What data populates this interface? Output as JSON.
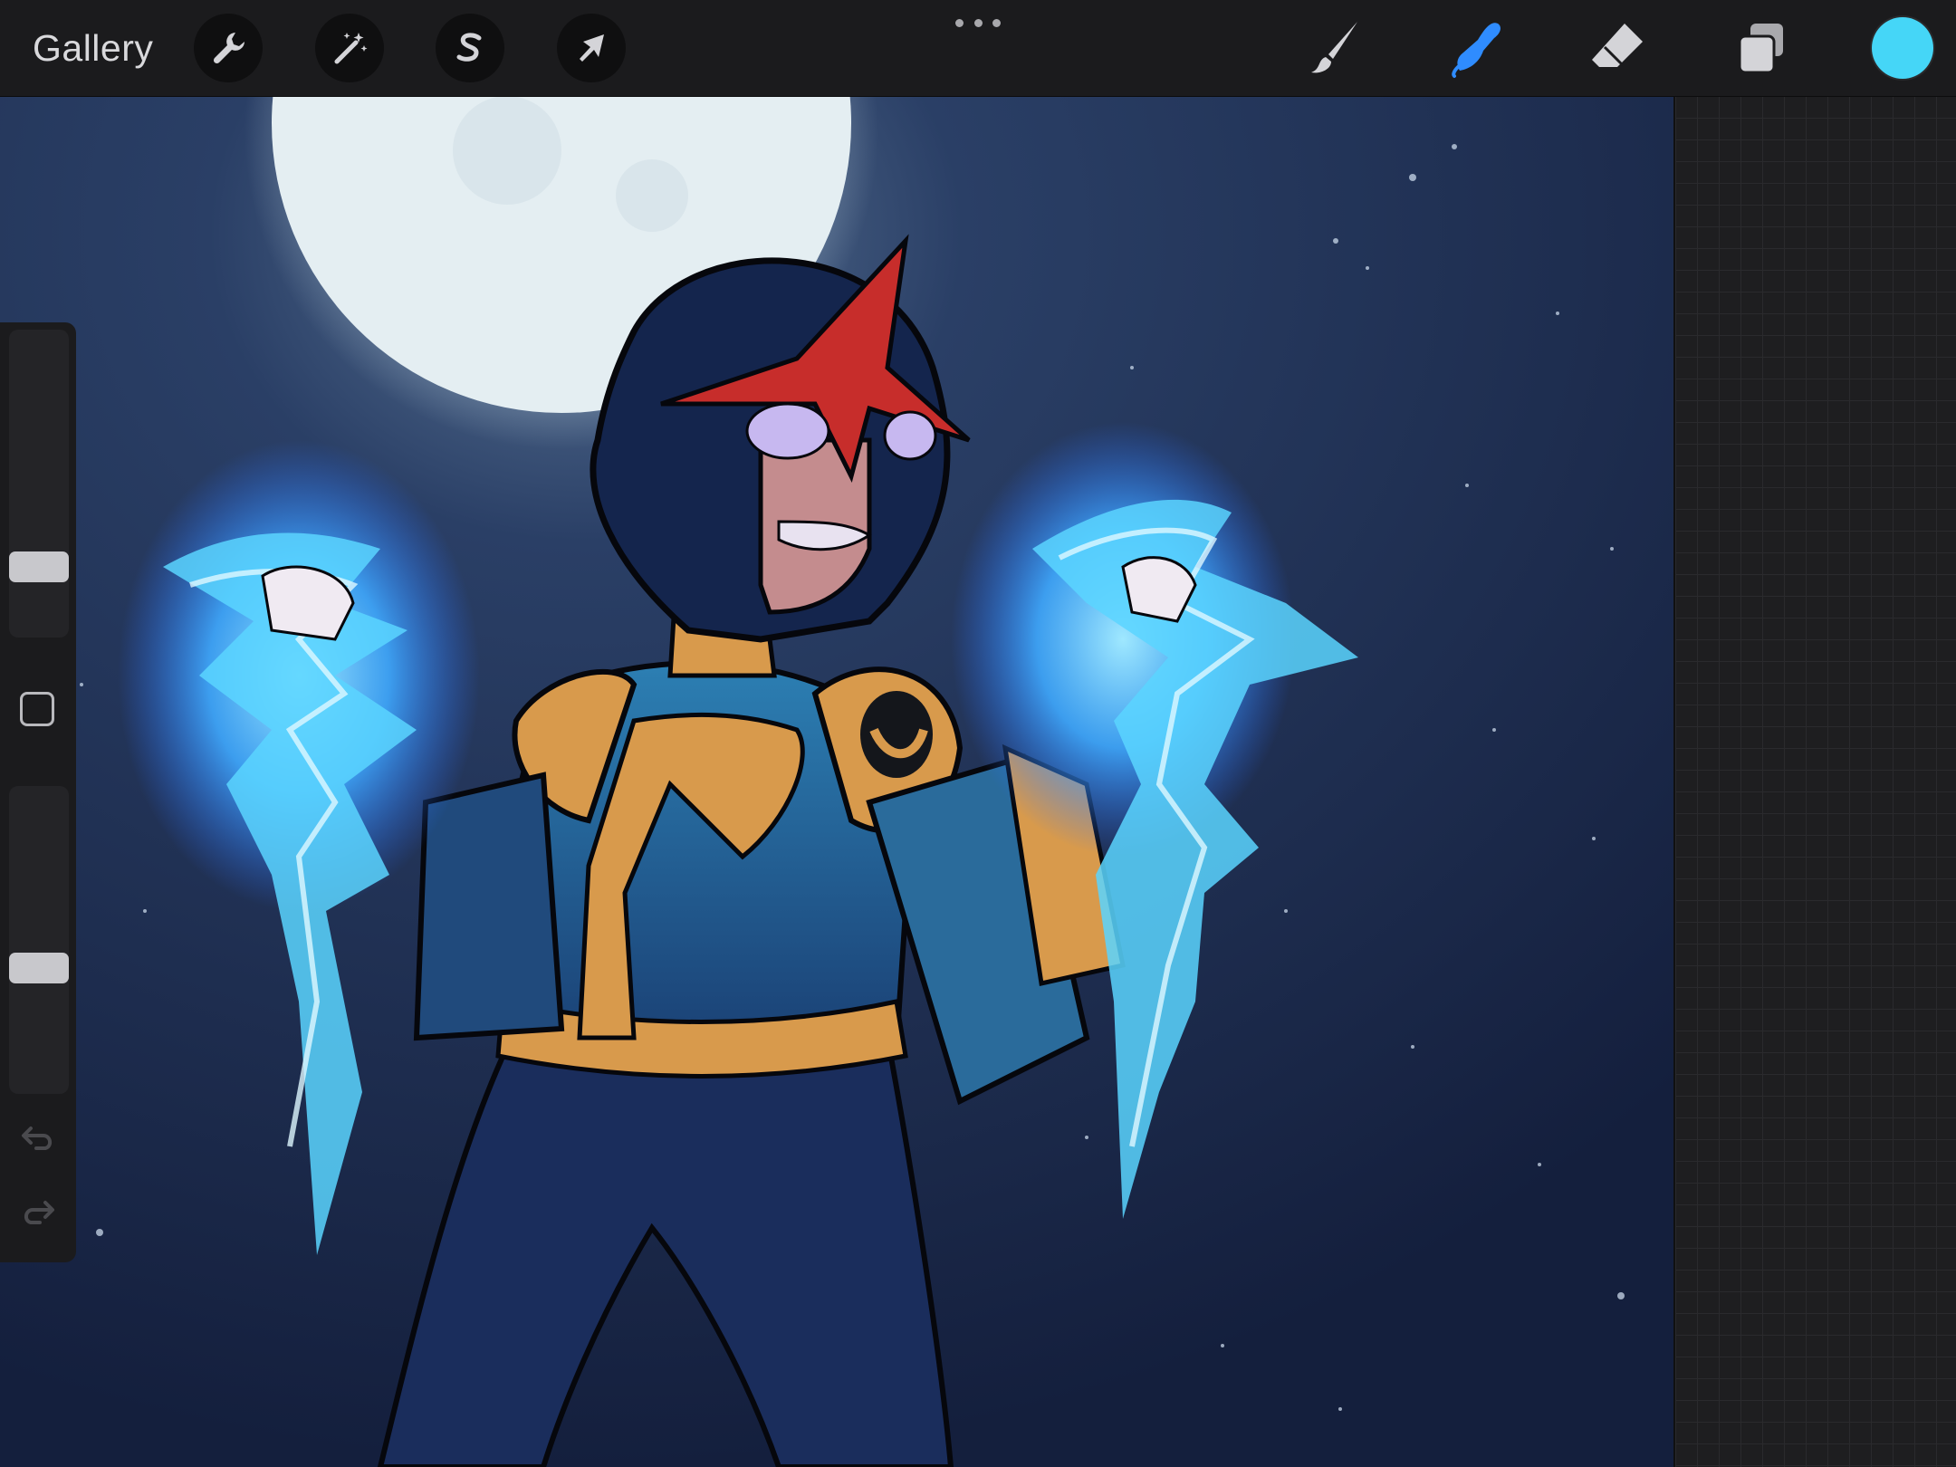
{
  "app": {
    "gallery_label": "Gallery",
    "accent_color": "#2f8cff",
    "current_color": "#45d6f7"
  },
  "toolbar": {
    "left_tools": [
      {
        "name": "actions",
        "icon": "wrench-icon"
      },
      {
        "name": "adjustments",
        "icon": "magic-wand-icon"
      },
      {
        "name": "selection",
        "icon": "selection-s-icon"
      },
      {
        "name": "transform",
        "icon": "arrow-cursor-icon"
      }
    ],
    "more_icon": "more-dots-icon",
    "right_tools": [
      {
        "name": "brush",
        "icon": "brush-icon",
        "active": false
      },
      {
        "name": "smudge",
        "icon": "smudge-finger-icon",
        "active": true
      },
      {
        "name": "eraser",
        "icon": "eraser-icon",
        "active": false
      },
      {
        "name": "layers",
        "icon": "layers-icon",
        "active": false
      }
    ]
  },
  "sidebar": {
    "brush_size_level": 0.2,
    "brush_opacity_level": 0.4,
    "modify_icon": "square-modify-icon",
    "undo_icon": "undo-icon",
    "redo_icon": "redo-icon"
  },
  "canvas": {
    "artwork": "superhero-illustration",
    "background_color": "#162447",
    "moon_color": "#e4eef2",
    "energy_color": "#45c9f9"
  }
}
